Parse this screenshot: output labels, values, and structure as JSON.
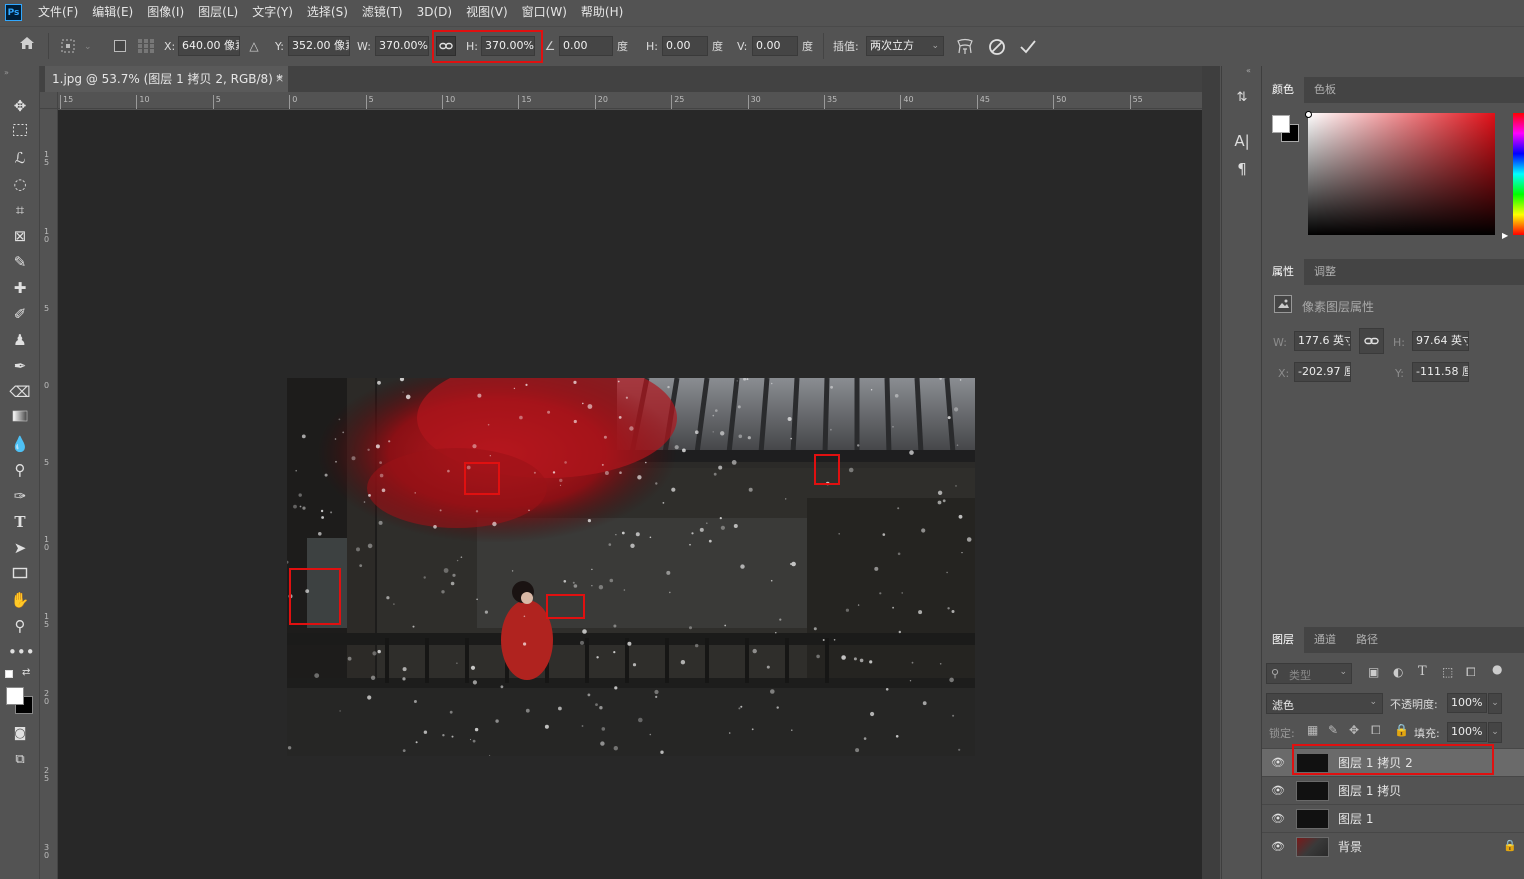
{
  "app": {
    "logo": "Ps"
  },
  "menu": [
    "文件(F)",
    "编辑(E)",
    "图像(I)",
    "图层(L)",
    "文字(Y)",
    "选择(S)",
    "滤镜(T)",
    "3D(D)",
    "视图(V)",
    "窗口(W)",
    "帮助(H)"
  ],
  "options": {
    "x_label": "X:",
    "x_value": "640.00 像素",
    "y_label": "Y:",
    "y_value": "352.00 像素",
    "w_label": "W:",
    "w_value": "370.00%",
    "h_label": "H:",
    "h_value": "370.00%",
    "angle_value": "0.00",
    "degree": "度",
    "hskew_label": "H:",
    "hskew_value": "0.00",
    "vskew_label": "V:",
    "vskew_value": "0.00",
    "interp_label": "插值:",
    "interp_value": "两次立方"
  },
  "doc_tab": {
    "title": "1.jpg @ 53.7% (图层 1 拷贝 2, RGB/8) *",
    "close": "×"
  },
  "ruler": {
    "h_ticks": [
      "15",
      "10",
      "5",
      "0",
      "5",
      "10",
      "15",
      "20",
      "25",
      "30",
      "35",
      "40",
      "45",
      "50",
      "55"
    ],
    "v_ticks": [
      "1\n5",
      "1\n0",
      "5",
      "0",
      "5",
      "1\n0",
      "1\n5",
      "2\n0",
      "2\n5",
      "3\n0"
    ]
  },
  "color_panel": {
    "tabs": [
      "颜色",
      "色板"
    ]
  },
  "properties": {
    "tabs": [
      "属性",
      "调整"
    ],
    "header": "像素图层属性",
    "w_label": "W:",
    "w_value": "177.6 英寸",
    "h_label": "H:",
    "h_value": "97.64 英寸",
    "x_label": "X:",
    "x_value": "-202.97 厘",
    "y_label": "Y:",
    "y_value": "-111.58 厘"
  },
  "layers_panel": {
    "tabs": [
      "图层",
      "通道",
      "路径"
    ],
    "filter_placeholder": "类型",
    "blend_mode": "滤色",
    "opacity_label": "不透明度:",
    "opacity_value": "100%",
    "lock_label": "锁定:",
    "fill_label": "填充:",
    "fill_value": "100%",
    "layers": [
      {
        "name": "图层 1 拷贝 2",
        "selected": true
      },
      {
        "name": "图层 1 拷贝",
        "selected": false
      },
      {
        "name": "图层 1",
        "selected": false
      },
      {
        "name": "背景",
        "selected": false,
        "locked": true
      }
    ]
  },
  "colors": {
    "highlight": "#e01010",
    "foreground": "#ffffff",
    "background": "#000000"
  }
}
